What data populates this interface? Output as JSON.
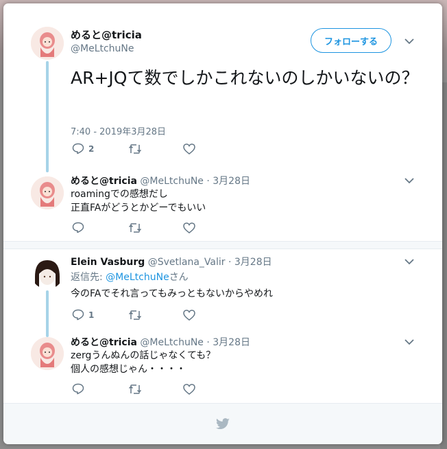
{
  "main_tweet": {
    "author_name": "めると@tricia",
    "author_handle": "@MeLtchuNe",
    "follow_label": "フォローする",
    "text": "AR+JQて数でしかこれないのしかいないの？",
    "timestamp": "7:40 - 2019年3月28日",
    "reply_count": "2",
    "retweet_count": "",
    "like_count": ""
  },
  "replies": [
    {
      "author_name": "めると@tricia",
      "author_handle": "@MeLtchuNe",
      "date": "· 3月28日",
      "lines": [
        "roamingでの感想だし",
        "正直FAがどうとかどーでもいい"
      ],
      "reply_count": ""
    },
    {
      "author_name": "Elein Vasburg",
      "author_handle": "@Svetlana_Valir",
      "date": "· 3月28日",
      "reply_to_prefix": "返信先: ",
      "reply_to_handle": "@MeLtchuNe",
      "reply_to_suffix": "さん",
      "lines": [
        "今のFAでそれ言ってもみっともないからやめれ"
      ],
      "reply_count": "1"
    },
    {
      "author_name": "めると@tricia",
      "author_handle": "@MeLtchuNe",
      "date": "· 3月28日",
      "lines": [
        "zergうんぬんの話じゃなくても？",
        "個人の感想じゃん・・・・"
      ],
      "reply_count": ""
    }
  ],
  "colors": {
    "accent": "#1c94e0",
    "thread_line": "#a6d3e8",
    "muted": "#657786",
    "footer_bg": "#f5f8fa"
  },
  "icons": [
    "chevron-down-icon",
    "reply-icon",
    "retweet-icon",
    "like-icon",
    "twitter-bird-icon"
  ]
}
